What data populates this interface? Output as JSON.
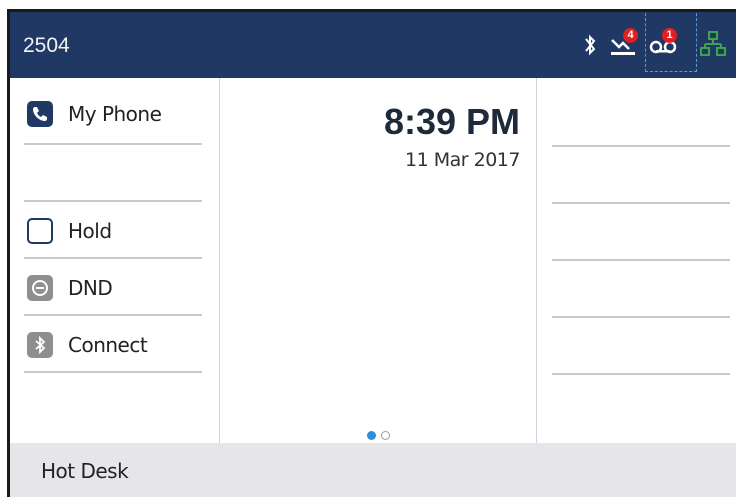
{
  "header": {
    "extension": "2504",
    "icons": [
      "bluetooth-icon",
      "missed-calls-icon",
      "voicemail-icon",
      "network-icon"
    ],
    "missed_calls_count": "4",
    "voicemail_count": "1",
    "colors": {
      "bar": "#1f3864",
      "badge": "#e02020",
      "network": "#3fa34d"
    }
  },
  "left_keys": [
    {
      "label": "My Phone",
      "icon": "phone-icon"
    },
    {
      "label": ""
    },
    {
      "label": "Hold",
      "icon": "empty-key-icon"
    },
    {
      "label": "DND",
      "icon": "dnd-icon"
    },
    {
      "label": "Connect",
      "icon": "bluetooth-icon"
    }
  ],
  "main": {
    "time": "8:39 PM",
    "date": "11 Mar 2017",
    "page_indicator": {
      "current": 1,
      "total": 2
    }
  },
  "footer": {
    "softkey": "Hot Desk"
  }
}
